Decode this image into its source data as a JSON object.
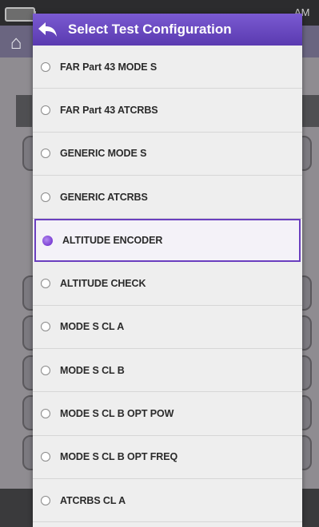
{
  "dialog": {
    "title": "Select Test Configuration",
    "accent_color": "#5f3fb5",
    "back_icon": "back-arrow-icon",
    "options": [
      {
        "label": "FAR Part 43 MODE S",
        "selected": false
      },
      {
        "label": "FAR Part 43 ATCRBS",
        "selected": false
      },
      {
        "label": "GENERIC MODE S",
        "selected": false
      },
      {
        "label": "GENERIC ATCRBS",
        "selected": false
      },
      {
        "label": "ALTITUDE ENCODER",
        "selected": true
      },
      {
        "label": "ALTITUDE CHECK",
        "selected": false
      },
      {
        "label": "MODE S CL A",
        "selected": false
      },
      {
        "label": "MODE S CL B",
        "selected": false
      },
      {
        "label": "MODE S CL B OPT POW",
        "selected": false
      },
      {
        "label": "MODE S CL B OPT FREQ",
        "selected": false
      },
      {
        "label": "ATCRBS CL A",
        "selected": false
      }
    ]
  },
  "background": {
    "status_time_suffix": "AM",
    "home_icon": "home-icon"
  }
}
